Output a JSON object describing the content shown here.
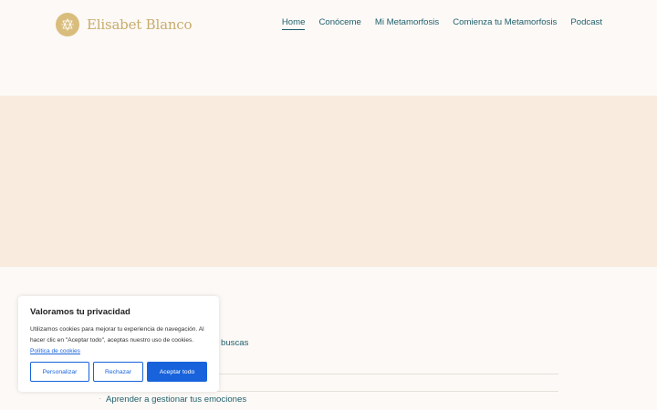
{
  "brand": {
    "name": "Elisabet Blanco",
    "logo_icon": "logo-badge-icon",
    "accent": "#d9bd7c"
  },
  "nav": {
    "items": [
      {
        "label": "Home",
        "active": true
      },
      {
        "label": "Conóceme",
        "active": false
      },
      {
        "label": "Mi Metamorfosis",
        "active": false
      },
      {
        "label": "Comienza tu Metamorfosis",
        "active": false
      },
      {
        "label": "Podcast",
        "active": false
      }
    ]
  },
  "list": {
    "items": [
      {
        "label": "buscas"
      },
      {
        "label": "Aprender a gestionar tus emociones"
      }
    ]
  },
  "cookie": {
    "title": "Valoramos tu privacidad",
    "text": "Utilizamos cookies para mejorar tu experiencia de navegación. Al hacer clic en \"Aceptar todo\", aceptas nuestro uso de cookies.",
    "link": "Política de cookies",
    "buttons": {
      "customize": "Personalizar",
      "reject": "Rechazar",
      "accept": "Aceptar todo"
    },
    "accent": "#1863dc"
  },
  "colors": {
    "hero_bg": "#f9ebdd",
    "page_bg": "#fcf9f6",
    "text": "#1f5f6b"
  }
}
